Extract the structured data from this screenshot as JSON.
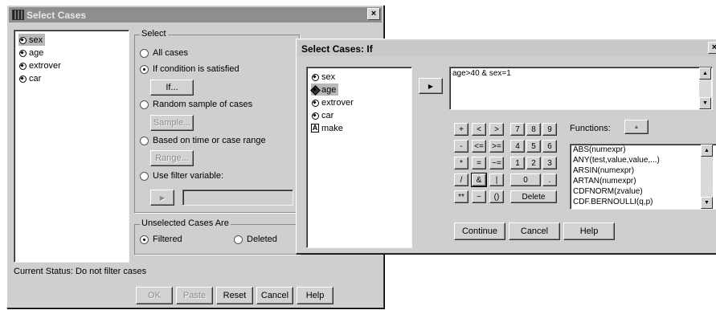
{
  "main_dialog": {
    "title": "Select Cases",
    "close_glyph": "×",
    "variables": [
      {
        "label": "sex",
        "icon": "numeric-variable-icon"
      },
      {
        "label": "age",
        "icon": "numeric-variable-icon"
      },
      {
        "label": "extrover",
        "icon": "numeric-variable-icon"
      },
      {
        "label": "car",
        "icon": "numeric-variable-icon"
      }
    ],
    "select_group": {
      "label": "Select",
      "all_cases": "All cases",
      "if_condition": "If condition is satisfied",
      "if_button": "If...",
      "random_sample": "Random sample of cases",
      "sample_button": "Sample...",
      "time_range": "Based on time or case range",
      "range_button": "Range...",
      "filter_variable": "Use filter variable:",
      "move_glyph": "▶",
      "selected_option": "If condition is satisfied"
    },
    "unselected_group": {
      "label": "Unselected Cases Are",
      "filtered": "Filtered",
      "deleted": "Deleted",
      "selected_option": "Filtered"
    },
    "status": "Current Status: Do not filter cases",
    "buttons": {
      "ok": "OK",
      "paste": "Paste",
      "reset": "Reset",
      "cancel": "Cancel",
      "help": "Help"
    }
  },
  "if_dialog": {
    "title": "Select Cases: If",
    "close_glyph": "×",
    "variables": [
      {
        "label": "sex",
        "icon": "numeric-variable-icon"
      },
      {
        "label": "age",
        "icon": "numeric-variable-icon",
        "selected": true
      },
      {
        "label": "extrover",
        "icon": "numeric-variable-icon"
      },
      {
        "label": "car",
        "icon": "numeric-variable-icon"
      },
      {
        "label": "make",
        "icon": "string-variable-icon",
        "icon_glyph": "A"
      }
    ],
    "move_glyph": "▶",
    "expression": "age>40 & sex=1",
    "keypad": [
      [
        "+",
        "<",
        ">",
        "7",
        "8",
        "9"
      ],
      [
        "-",
        "<=",
        ">=",
        "4",
        "5",
        "6"
      ],
      [
        "*",
        "=",
        "~=",
        "1",
        "2",
        "3"
      ],
      [
        "/",
        "&",
        "|",
        "0",
        "."
      ],
      [
        "**",
        "~",
        "()",
        "Delete"
      ]
    ],
    "functions_label": "Functions:",
    "functions_up_glyph": "▲",
    "functions": [
      "ABS(numexpr)",
      "ANY(test,value,value,...)",
      "ARSIN(numexpr)",
      "ARTAN(numexpr)",
      "CDFNORM(zvalue)",
      "CDF.BERNOULLI(q,p)"
    ],
    "buttons": {
      "continue": "Continue",
      "cancel": "Cancel",
      "help": "Help"
    }
  },
  "scroll_glyphs": {
    "up": "▲",
    "down": "▼"
  }
}
